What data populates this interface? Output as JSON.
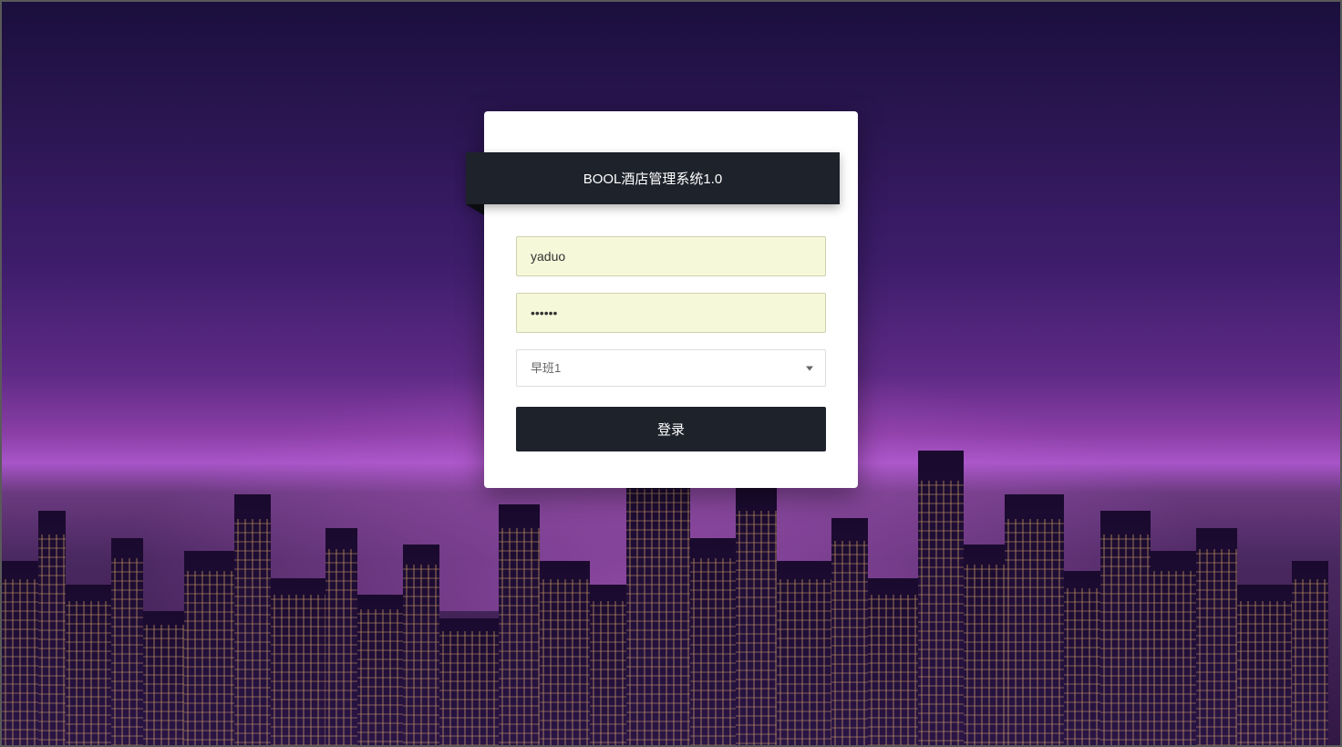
{
  "login": {
    "title": "BOOL酒店管理系统1.0",
    "username_value": "yaduo",
    "password_value": "••••••",
    "shift_selected": "早班1",
    "login_button": "登录"
  }
}
